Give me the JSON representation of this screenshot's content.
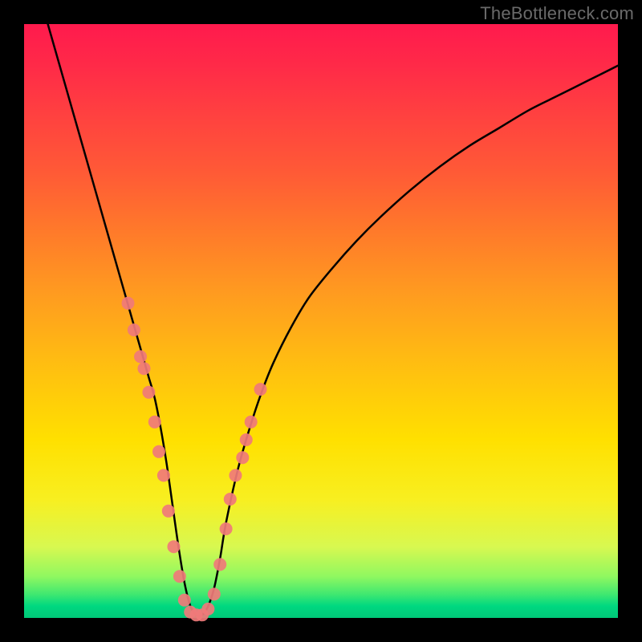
{
  "watermark": "TheBottleneck.com",
  "chart_data": {
    "type": "line",
    "title": "",
    "xlabel": "",
    "ylabel": "",
    "xlim": [
      0,
      100
    ],
    "ylim": [
      0,
      100
    ],
    "grid": false,
    "series": [
      {
        "name": "curve",
        "color": "#000000",
        "x": [
          4,
          6,
          8,
          10,
          12,
          14,
          16,
          18,
          20,
          21,
          22,
          23,
          24,
          25,
          26,
          27,
          28,
          29,
          30,
          31,
          32,
          33,
          34,
          36,
          38,
          40,
          42,
          45,
          48,
          52,
          56,
          60,
          65,
          70,
          75,
          80,
          85,
          90,
          95,
          100
        ],
        "y": [
          100,
          93,
          86,
          79,
          72,
          65,
          58,
          51,
          44,
          40.5,
          37,
          32,
          26,
          19,
          12,
          6,
          2,
          0.5,
          0.5,
          2,
          5,
          10,
          16,
          25,
          32,
          38,
          43,
          49,
          54,
          59,
          63.5,
          67.5,
          72,
          76,
          79.5,
          82.5,
          85.5,
          88,
          90.5,
          93
        ]
      }
    ],
    "markers": [
      {
        "name": "dots",
        "color": "#f07a7a",
        "radius_px": 8,
        "x": [
          17.5,
          18.5,
          19.6,
          20.2,
          21.0,
          22.0,
          22.7,
          23.5,
          24.3,
          25.2,
          26.2,
          27.0,
          28.0,
          29.0,
          30.0,
          31.0,
          32.0,
          33.0,
          34.0,
          34.7,
          35.6,
          36.8,
          37.4,
          38.2,
          39.8
        ],
        "y": [
          53,
          48.5,
          44.0,
          42.0,
          38.0,
          33.0,
          28.0,
          24.0,
          18.0,
          12.0,
          7.0,
          3.0,
          1.0,
          0.5,
          0.5,
          1.5,
          4.0,
          9.0,
          15.0,
          20.0,
          24.0,
          27.0,
          30.0,
          33.0,
          38.5
        ]
      }
    ]
  }
}
